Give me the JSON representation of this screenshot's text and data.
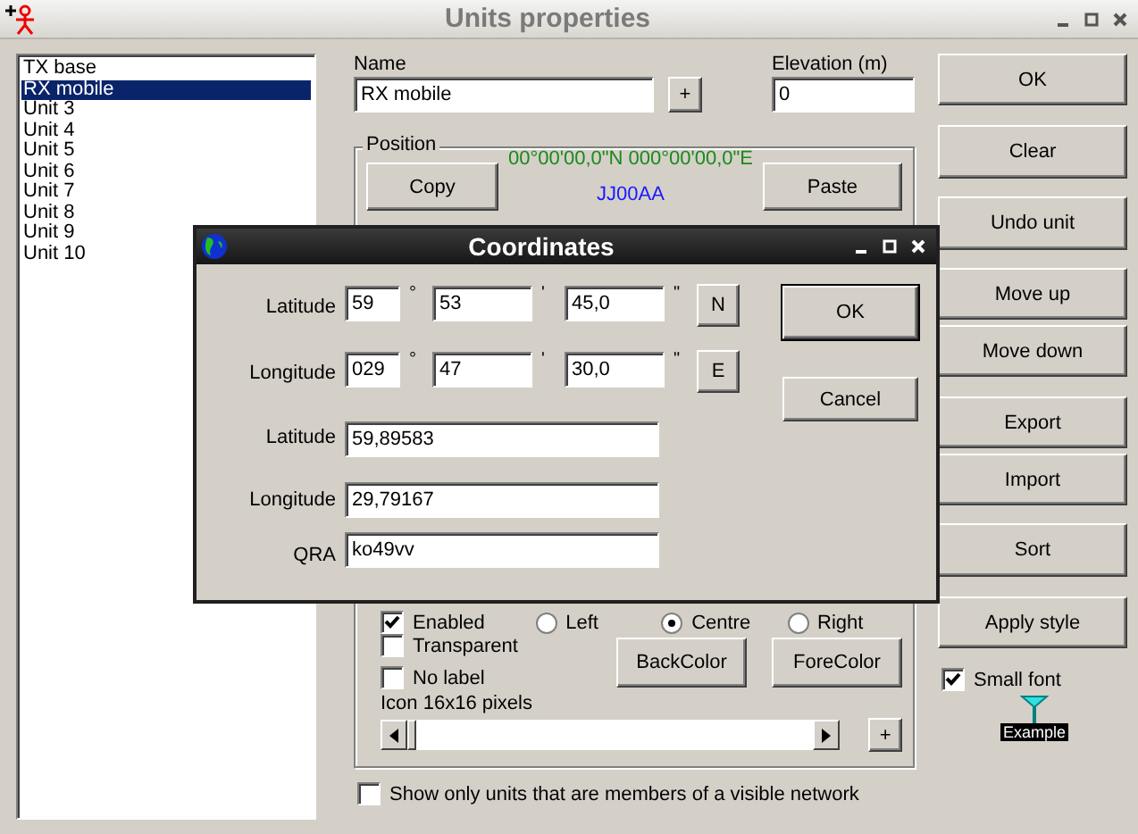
{
  "window": {
    "title": "Units properties"
  },
  "units_list": {
    "items": [
      {
        "label": "TX base",
        "selected": false
      },
      {
        "label": "RX mobile",
        "selected": true
      },
      {
        "label": "Unit 3",
        "selected": false
      },
      {
        "label": "Unit 4",
        "selected": false
      },
      {
        "label": "Unit 5",
        "selected": false
      },
      {
        "label": "Unit 6",
        "selected": false
      },
      {
        "label": "Unit 7",
        "selected": false
      },
      {
        "label": "Unit 8",
        "selected": false
      },
      {
        "label": "Unit 9",
        "selected": false
      },
      {
        "label": "Unit 10",
        "selected": false
      }
    ]
  },
  "name": {
    "label": "Name",
    "value": "RX mobile",
    "add_button": "+"
  },
  "elevation": {
    "label": "Elevation (m)",
    "value": "0"
  },
  "position": {
    "title": "Position",
    "copy_button": "Copy",
    "paste_button": "Paste",
    "coordinates": "00°00'00,0\"N 000°00'00,0\"E",
    "locator": "JJ00AA"
  },
  "label_style": {
    "enabled": {
      "label": "Enabled",
      "checked": true
    },
    "alignment": [
      {
        "label": "Left",
        "selected": false
      },
      {
        "label": "Centre",
        "selected": true
      },
      {
        "label": "Right",
        "selected": false
      }
    ],
    "transparent": {
      "label": "Transparent",
      "checked": false
    },
    "no_label": {
      "label": "No label",
      "checked": false
    },
    "back_color_button": "BackColor",
    "fore_color_button": "ForeColor",
    "icon_size": "Icon 16x16 pixels",
    "icon_slider": {
      "level": 0
    },
    "add_button": "+"
  },
  "show_only": {
    "label": "Show only units that are members of a visible network",
    "checked": false
  },
  "side_buttons": [
    "OK",
    "Clear",
    "Undo unit",
    "Move up",
    "Move down",
    "Export",
    "Import",
    "Sort",
    "Apply style"
  ],
  "small_font": {
    "label": "Small font",
    "checked": true
  },
  "example_label": "Example",
  "dialog": {
    "title": "Coordinates",
    "dms_rows": [
      {
        "label": "Latitude",
        "degrees": "59",
        "minutes": "53",
        "seconds": "45,0",
        "hemisphere": "N"
      },
      {
        "label": "Longitude",
        "degrees": "029",
        "minutes": "47",
        "seconds": "30,0",
        "hemisphere": "E"
      }
    ],
    "units": [
      "°",
      "'",
      "\""
    ],
    "decimal_rows": [
      {
        "label": "Latitude",
        "value": "59,89583"
      },
      {
        "label": "Longitude",
        "value": "29,79167"
      },
      {
        "label": "QRA",
        "value": "ko49vv"
      }
    ],
    "ok_button": "OK",
    "cancel_button": "Cancel"
  }
}
